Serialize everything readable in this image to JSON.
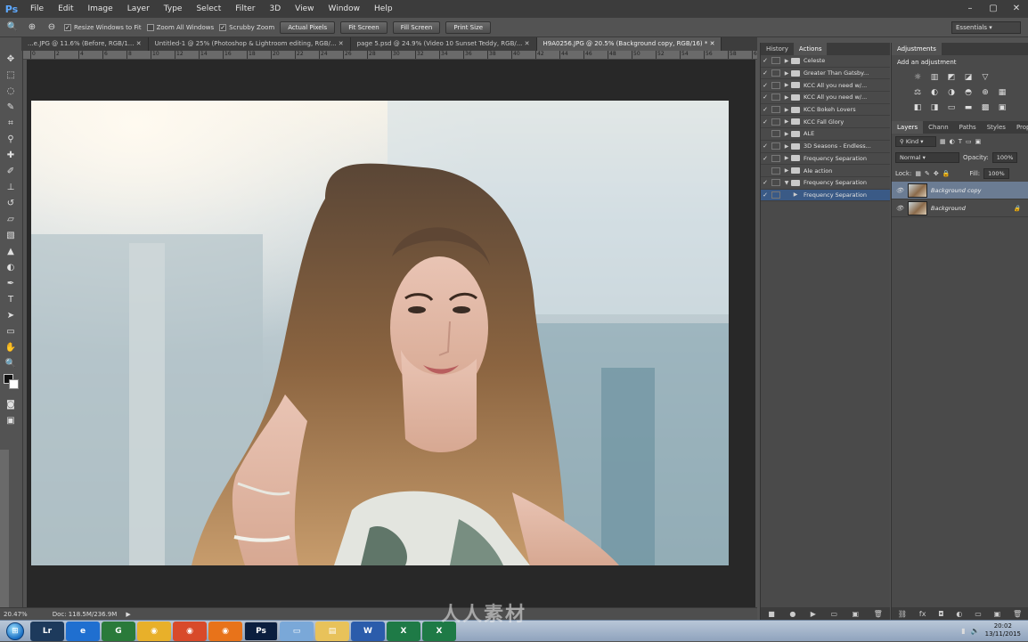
{
  "app": {
    "logo": "Ps"
  },
  "menu": [
    "File",
    "Edit",
    "Image",
    "Layer",
    "Type",
    "Select",
    "Filter",
    "3D",
    "View",
    "Window",
    "Help"
  ],
  "window_controls": [
    "–",
    "▢",
    "✕"
  ],
  "options_bar": {
    "resize_windows": "Resize Windows to Fit",
    "zoom_all": "Zoom All Windows",
    "scrubby_zoom": "Scrubby Zoom",
    "actual_pixels": "Actual Pixels",
    "fit_screen": "Fit Screen",
    "fill_screen": "Fill Screen",
    "print_size": "Print Size",
    "workspace": "Essentials"
  },
  "tabs": [
    {
      "label": "...e.JPG @ 11.6% (Before, RGB/1... ✕",
      "active": false
    },
    {
      "label": "Untitled-1 @ 25% (Photoshop & Lightroom editing, RGB/... ✕",
      "active": false
    },
    {
      "label": "page 5.psd @ 24.9% (Video 10  Sunset Teddy, RGB/... ✕",
      "active": false
    },
    {
      "label": "H9A0256.JPG @ 20.5% (Background copy, RGB/16) * ✕",
      "active": true
    }
  ],
  "ruler_ticks": [
    "0",
    "2",
    "4",
    "6",
    "8",
    "10",
    "12",
    "14",
    "16",
    "18",
    "20",
    "22",
    "24",
    "26",
    "28",
    "30",
    "32",
    "34",
    "36",
    "38",
    "40",
    "42",
    "44",
    "46",
    "48",
    "50",
    "52",
    "54",
    "56",
    "58",
    "60"
  ],
  "status": {
    "zoom": "20.47%",
    "doc": "Doc: 118.5M/236.9M"
  },
  "panel1": {
    "tabs": [
      "History",
      "Actions"
    ],
    "actions": [
      {
        "label": "Celeste",
        "expanded": false,
        "checked": true,
        "selected": false,
        "indent": false
      },
      {
        "label": "Greater Than Gatsby...",
        "expanded": false,
        "checked": true,
        "selected": false,
        "indent": false
      },
      {
        "label": "KCC All you need w/...",
        "expanded": false,
        "checked": true,
        "selected": false,
        "indent": false
      },
      {
        "label": "KCC All you need w/...",
        "expanded": false,
        "checked": true,
        "selected": false,
        "indent": false
      },
      {
        "label": "KCC Bokeh Lovers",
        "expanded": false,
        "checked": true,
        "selected": false,
        "indent": false
      },
      {
        "label": "KCC Fall Glory",
        "expanded": false,
        "checked": true,
        "selected": false,
        "indent": false
      },
      {
        "label": "ALE",
        "expanded": false,
        "checked": false,
        "selected": false,
        "indent": false
      },
      {
        "label": "3D Seasons - Endless...",
        "expanded": false,
        "checked": true,
        "selected": false,
        "indent": false
      },
      {
        "label": "Frequency Separation",
        "expanded": false,
        "checked": true,
        "selected": false,
        "indent": false
      },
      {
        "label": "Ale action",
        "expanded": false,
        "checked": false,
        "selected": false,
        "indent": false
      },
      {
        "label": "Frequency Separation",
        "expanded": true,
        "checked": true,
        "selected": false,
        "indent": false
      },
      {
        "label": "Frequency Separation",
        "expanded": false,
        "checked": true,
        "selected": true,
        "indent": true
      }
    ]
  },
  "panel2": {
    "adjustments_tab": "Adjustments",
    "adjustments_title": "Add an adjustment",
    "adj_icons": [
      "☼",
      "▥",
      "◩",
      "◪",
      "▽",
      "",
      "⚖",
      "◐",
      "◑",
      "◓",
      "⊕",
      "▦",
      "◧",
      "◨",
      "▭",
      "▬",
      "▩",
      "▣"
    ],
    "layer_tabs": [
      "Layers",
      "Chann",
      "Paths",
      "Styles",
      "Proper"
    ],
    "kind": "Kind",
    "blend_mode": "Normal",
    "opacity_label": "Opacity:",
    "opacity_value": "100%",
    "lock_label": "Lock:",
    "fill_label": "Fill:",
    "fill_value": "100%",
    "layers": [
      {
        "name": "Background copy",
        "selected": true,
        "locked": false
      },
      {
        "name": "Background",
        "selected": false,
        "locked": true
      }
    ]
  },
  "taskbar": {
    "apps": [
      "Lr",
      "e",
      "G",
      "◉",
      "◉",
      "◉",
      "Ps",
      "▭",
      "▤",
      "W",
      "X",
      "X"
    ],
    "clock_time": "20:02",
    "clock_date": "13/11/2015"
  },
  "watermark": "人人素材"
}
